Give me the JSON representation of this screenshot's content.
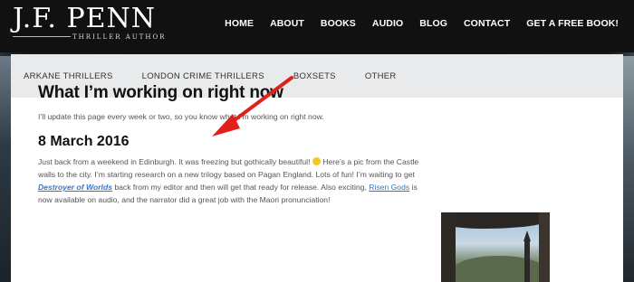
{
  "logo": {
    "main": "J.F. PENN",
    "sub": "THRILLER AUTHOR"
  },
  "mainnav": [
    "HOME",
    "ABOUT",
    "BOOKS",
    "AUDIO",
    "BLOG",
    "CONTACT",
    "GET A FREE BOOK!"
  ],
  "subnav": [
    "ARKANE THRILLERS",
    "LONDON CRIME THRILLERS",
    "BOXSETS",
    "OTHER"
  ],
  "content": {
    "title": "What I’m working on right now",
    "intro": "I’ll update this page every week or two, so you know what I’m working on right now.",
    "date": "8 March 2016",
    "p1": "Just back from a weekend in Edinburgh. It was freezing but gothically beautiful!",
    "p2": "Here’s a pic from the Castle walls to the city. I’m starting research on a new trilogy based on Pagan England. Lots of fun! I’m waiting to get",
    "book": "Destroyer of Worlds",
    "p3": "back from my editor and then will get that ready for release. Also exciting,",
    "book2": "Risen Gods",
    "p4": "is now available on audio, and the narrator did a great job with the Maori pronunciation!"
  },
  "colors": {
    "link": "#3a75c4",
    "arrow": "#e0201b",
    "subnav_bg": "#e8eaec"
  }
}
